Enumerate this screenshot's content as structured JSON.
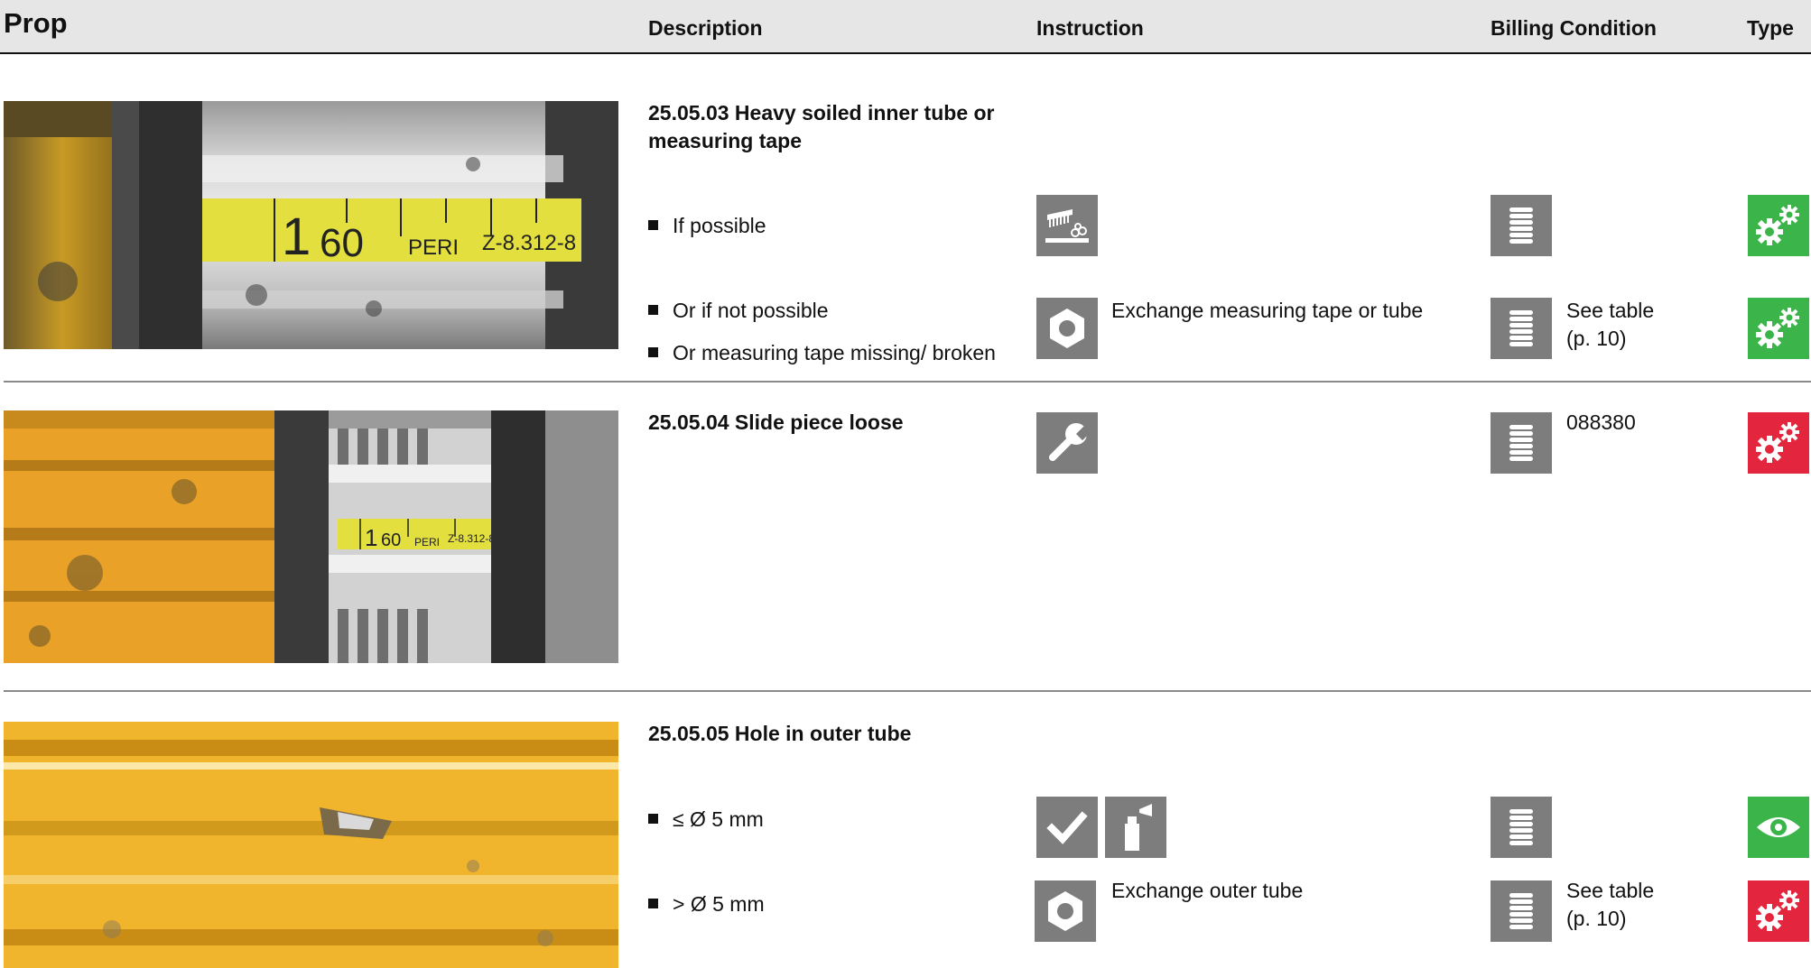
{
  "header": {
    "prop": "Prop",
    "description": "Description",
    "instruction": "Instruction",
    "billing": "Billing Condition",
    "type": "Type"
  },
  "rows": [
    {
      "title": "25.05.03 Heavy soiled inner tube or measuring tape",
      "photo_label": {
        "number": "1",
        "value": "60",
        "brand": "PERI",
        "code": "Z-8.312-8"
      },
      "items": [
        {
          "condition": "If possible",
          "instruction_icons": [
            "cleaning-icon"
          ],
          "instruction_text": "",
          "billing_icon": "coin-stack-icon",
          "billing_text": "",
          "type_icon": "gears-icon",
          "type_color": "#3bb54a"
        },
        {
          "condition": "Or if not possible",
          "condition_2": "Or measuring tape missing/ broken",
          "instruction_icons": [
            "nut-icon"
          ],
          "instruction_text": "Exchange measuring tape or tube",
          "billing_icon": "coin-stack-icon",
          "billing_text": "See table",
          "billing_text_2": "(p. 10)",
          "type_icon": "gears-icon",
          "type_color": "#3bb54a"
        }
      ]
    },
    {
      "title": "25.05.04 Slide piece loose",
      "photo_label": {
        "number": "1",
        "value": "60",
        "brand": "PERI",
        "code": "Z-8.312-8"
      },
      "items": [
        {
          "instruction_icons": [
            "wrench-icon"
          ],
          "billing_icon": "coin-stack-icon",
          "billing_text": "088380",
          "type_icon": "gears-icon",
          "type_color": "#e3263d"
        }
      ]
    },
    {
      "title": "25.05.05 Hole in outer tube",
      "items": [
        {
          "condition": "≤ Ø 5 mm",
          "instruction_icons": [
            "checkmark-icon",
            "spray-can-icon"
          ],
          "instruction_text": "",
          "billing_icon": "coin-stack-icon",
          "billing_text": "",
          "type_icon": "eye-icon",
          "type_color": "#3bb54a"
        },
        {
          "condition": "> Ø 5 mm",
          "instruction_icons": [
            "nut-icon"
          ],
          "instruction_text": "Exchange outer tube",
          "billing_icon": "coin-stack-icon",
          "billing_text": "See table",
          "billing_text_2": "(p. 10)",
          "type_icon": "gears-icon",
          "type_color": "#e3263d"
        }
      ]
    }
  ]
}
